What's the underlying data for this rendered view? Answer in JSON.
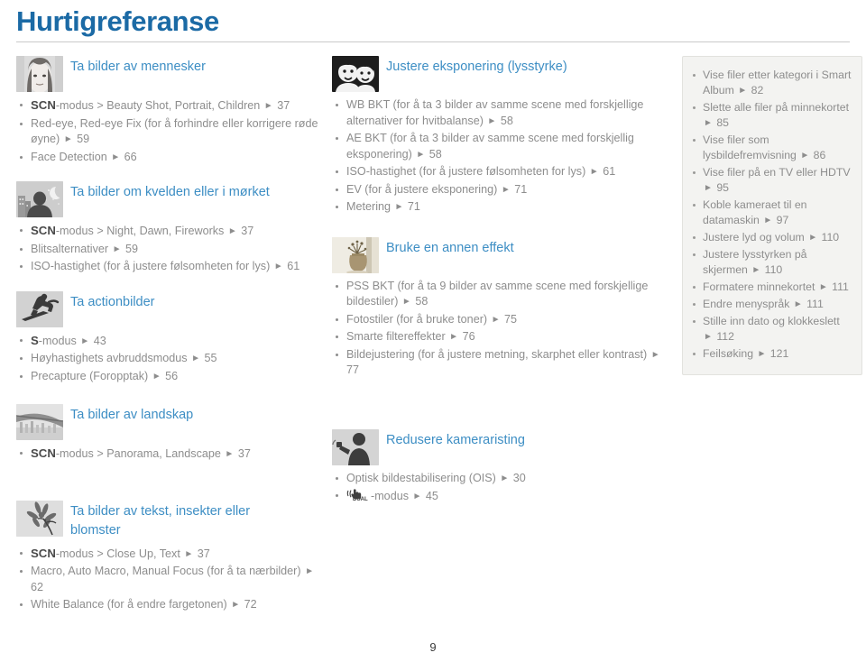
{
  "header": {
    "title": "Hurtigreferanse"
  },
  "page_number": "9",
  "colors": {
    "title_blue": "#1b6aa5",
    "section_blue": "#3d8ec4",
    "body_gray": "#8d8d8d",
    "panel_bg": "#f3f3f1"
  },
  "columns": {
    "left": [
      {
        "icon": "portrait-photo-thumb",
        "title": "Ta bilder av mennesker",
        "items": [
          {
            "tag": "SCN",
            "text": "-modus > Beauty Shot, Portrait, Children",
            "page": "37"
          },
          {
            "tag": "",
            "text": "Red-eye, Red-eye Fix (for å forhindre eller korrigere røde øyne)",
            "page": "59"
          },
          {
            "tag": "",
            "text": "Face Detection",
            "page": "66"
          }
        ]
      },
      {
        "icon": "night-scene-thumb",
        "title": "Ta bilder om kvelden eller i mørket",
        "items": [
          {
            "tag": "SCN",
            "text": "-modus > Night, Dawn, Fireworks",
            "page": "37"
          },
          {
            "tag": "",
            "text": "Blitsalternativer",
            "page": "59"
          },
          {
            "tag": "",
            "text": "ISO-hastighet (for å justere følsomheten for lys)",
            "page": "61"
          }
        ]
      },
      {
        "icon": "snowboarder-action-thumb",
        "title": "Ta actionbilder",
        "items": [
          {
            "tag": "S",
            "text": "-modus",
            "page": "43"
          },
          {
            "tag": "",
            "text": "Høyhastighets avbruddsmodus",
            "page": "55"
          },
          {
            "tag": "",
            "text": "Precapture (Foropptak)",
            "page": "56"
          }
        ]
      },
      {
        "icon": "bridge-landscape-thumb",
        "title": "Ta bilder av landskap",
        "items": [
          {
            "tag": "SCN",
            "text": "-modus > Panorama, Landscape",
            "page": "37"
          }
        ]
      },
      {
        "icon": "flower-macro-thumb",
        "title": "Ta bilder av tekst, insekter eller blomster",
        "items": [
          {
            "tag": "SCN",
            "text": "-modus > Close Up, Text",
            "page": "37"
          },
          {
            "tag": "",
            "text": "Macro, Auto Macro, Manual Focus (for å ta nærbilder)",
            "page": "62"
          },
          {
            "tag": "",
            "text": "White Balance (for å endre fargetonen)",
            "page": "72"
          }
        ]
      }
    ],
    "middle": [
      {
        "icon": "two-faces-exposure-thumb",
        "title": "Justere eksponering (lysstyrke)",
        "items": [
          {
            "tag": "",
            "text": "WB BKT (for å ta 3 bilder av samme scene med forskjellige alternativer for hvitbalanse)",
            "page": "58"
          },
          {
            "tag": "",
            "text": "AE BKT (for å ta 3 bilder av samme scene med forskjellig eksponering)",
            "page": "58"
          },
          {
            "tag": "",
            "text": "ISO-hastighet (for å justere følsomheten for lys)",
            "page": "61"
          },
          {
            "tag": "",
            "text": "EV (for å justere eksponering)",
            "page": "71"
          },
          {
            "tag": "",
            "text": "Metering",
            "page": "71"
          }
        ]
      },
      {
        "icon": "vase-effect-thumb",
        "title": "Bruke en annen effekt",
        "items": [
          {
            "tag": "",
            "text": "PSS BKT (for å ta 9 bilder av samme scene med forskjellige bildestiler)",
            "page": "58"
          },
          {
            "tag": "",
            "text": "Fotostiler (for å bruke toner)",
            "page": "75"
          },
          {
            "tag": "",
            "text": "Smarte filtereffekter",
            "page": "76"
          },
          {
            "tag": "",
            "text": "Bildejustering (for å justere metning, skarphet eller kontrast)",
            "page": "77"
          }
        ]
      },
      {
        "icon": "shaking-camera-thumb",
        "title": "Redusere kameraristing",
        "items": [
          {
            "tag": "",
            "text": "Optisk bildestabilisering (OIS)",
            "page": "30"
          },
          {
            "tag": "DUAL",
            "text": "-modus",
            "page": "45",
            "glyph": "dual-is-icon"
          }
        ]
      }
    ],
    "right": {
      "items": [
        {
          "text": "Vise filer etter kategori i Smart Album",
          "page": "82"
        },
        {
          "text": "Slette alle filer på minnekortet",
          "page": "85"
        },
        {
          "text": "Vise filer som lysbildefremvisning",
          "page": "86"
        },
        {
          "text": "Vise filer på en TV eller HDTV",
          "page": "95"
        },
        {
          "text": "Koble kameraet til en datamaskin",
          "page": "97"
        },
        {
          "text": "Justere lyd og volum",
          "page": "110"
        },
        {
          "text": "Justere lysstyrken på skjermen",
          "page": "110"
        },
        {
          "text": "Formatere minnekortet",
          "page": "111"
        },
        {
          "text": "Endre menyspråk",
          "page": "111"
        },
        {
          "text": "Stille inn dato og klokkeslett",
          "page": "112"
        },
        {
          "text": "Feilsøking",
          "page": "121"
        }
      ]
    }
  }
}
